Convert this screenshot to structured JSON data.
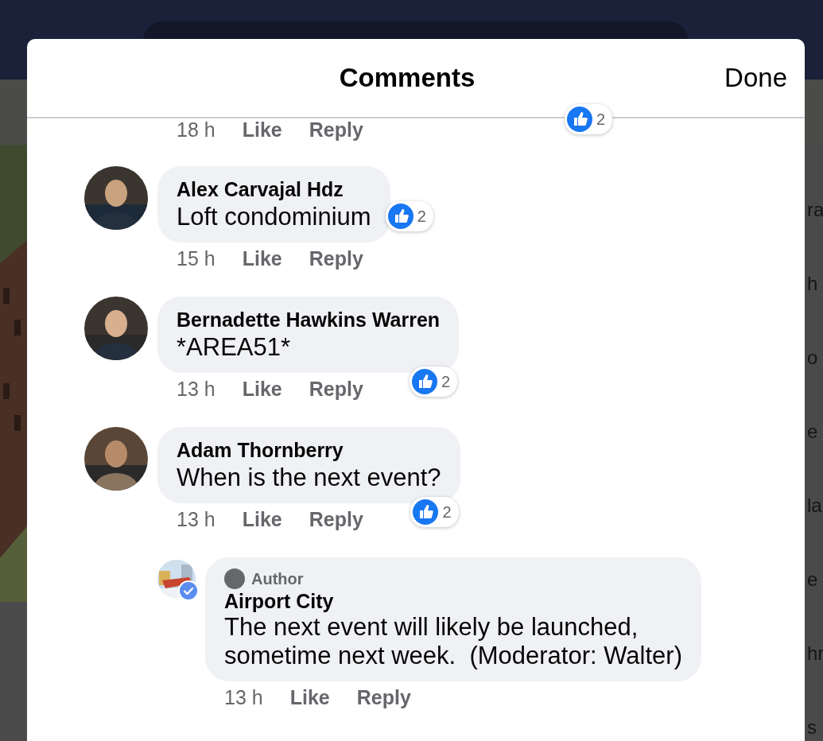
{
  "background": {
    "side_list": [
      "ra",
      "h",
      "o",
      "e",
      "la",
      "e",
      "hr",
      "s"
    ]
  },
  "dialog": {
    "title": "Comments",
    "done": "Done"
  },
  "partial_row": {
    "time": "18 h",
    "like": "Like",
    "reply": "Reply",
    "reactions": "2"
  },
  "comments": [
    {
      "name": "Alex Carvajal Hdz",
      "text": "Loft condominium",
      "time": "15 h",
      "like": "Like",
      "reply": "Reply",
      "reactions": "2",
      "badge_beside_text": true
    },
    {
      "name": "Bernadette Hawkins Warren",
      "text": "*AREA51*",
      "time": "13 h",
      "like": "Like",
      "reply": "Reply",
      "reactions": "2",
      "badge_beside_text": false
    },
    {
      "name": "Adam Thornberry",
      "text": "When is the next event?",
      "time": "13 h",
      "like": "Like",
      "reply": "Reply",
      "reactions": "2",
      "badge_beside_text": false
    }
  ],
  "reply": {
    "badge": "Author",
    "name": "Airport City",
    "verified": true,
    "lines": [
      "The next event will likely be launched,",
      "sometime next week.  (Moderator: Walter)"
    ],
    "time": "13 h",
    "like": "Like",
    "reply": "Reply"
  }
}
